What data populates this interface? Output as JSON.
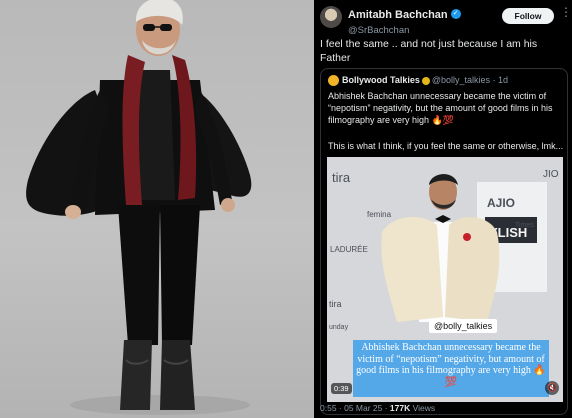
{
  "tweet": {
    "author_name": "Amitabh Bachchan",
    "author_handle": "@SrBachchan",
    "follow_label": "Follow",
    "more_icon": "more-icon",
    "text": "I feel the same .. and not just because I am his Father",
    "quote": {
      "author_name": "Bollywood Talkies",
      "author_handle": "@bolly_talkies",
      "age": "· 1d",
      "text": "Abhishek Bachchan unnecessary became the victim of “nepotism” negativity, but the amount of good films in his filmography are very high 🔥💯",
      "text_more": "This is what I think, if you feel the same or otherwise, lmk...",
      "video": {
        "handle_badge": "@bolly_talkies",
        "caption": "Abhishek Bachchan unnecessary became the victim of “nepotism” negativity, but amount of good films in his filmography are very high 🔥💯",
        "timer": "0:39",
        "backdrop_words": [
          "tira",
          "AJIO",
          "LADURÉE",
          "femina",
          "Times",
          "YLISH",
          "unday",
          "tira",
          "JIO"
        ]
      }
    },
    "meta": {
      "time": "0:55 · 05 Mar 25 · ",
      "views_count": "177K",
      "views_label": " Views"
    }
  },
  "colors": {
    "verified_blue": "#1d9bf0",
    "caption_bg": "#55a8e8",
    "scarf": "#7a1d22"
  }
}
